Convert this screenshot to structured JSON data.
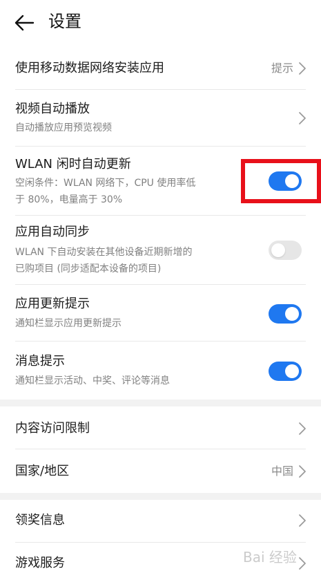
{
  "header": {
    "title": "设置",
    "back_icon": "arrow-left-icon"
  },
  "rows": {
    "mobile_data": {
      "label": "使用移动数据网络安装应用",
      "value": "提示"
    },
    "video_autoplay": {
      "label": "视频自动播放",
      "sub": "自动播放应用预览视频"
    },
    "wlan_update": {
      "label": "WLAN 闲时自动更新",
      "sub1": "空闲条件：WLAN 网络下，CPU 使用率低",
      "sub2": "于 80%，电量高于 30%",
      "toggle_on": true
    },
    "app_sync": {
      "label": "应用自动同步",
      "sub1": "WLAN 下自动安装在其他设备近期新增的",
      "sub2": "已购项目 (同步适配本设备的项目)",
      "toggle_on": false
    },
    "update_tip": {
      "label": "应用更新提示",
      "sub": "通知栏显示应用更新提示",
      "toggle_on": true
    },
    "message_tip": {
      "label": "消息提示",
      "sub": "通知栏显示活动、中奖、评论等消息",
      "toggle_on": true
    },
    "content_limit": {
      "label": "内容访问限制"
    },
    "region": {
      "label": "国家/地区",
      "value": "中国"
    },
    "prize_info": {
      "label": "领奖信息"
    },
    "game_service": {
      "label": "游戏服务"
    }
  },
  "colors": {
    "toggle_on": "#1f78f0",
    "toggle_off": "#e6e6e6",
    "highlight": "#e8101a"
  },
  "watermark": "Bai 经验"
}
